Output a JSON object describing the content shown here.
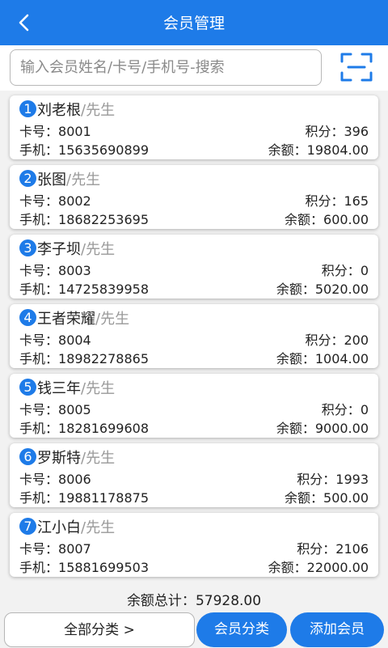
{
  "header": {
    "title": "会员管理"
  },
  "search": {
    "placeholder": "输入会员姓名/卡号/手机号-搜索"
  },
  "labels": {
    "card": "卡号：",
    "points": "积分：",
    "phone": "手机：",
    "balance": "余额："
  },
  "members": [
    {
      "index": "1",
      "name": "刘老根",
      "title": "/先生",
      "card": "8001",
      "points": "396",
      "phone": "15635690899",
      "balance": "19804.00"
    },
    {
      "index": "2",
      "name": "张图",
      "title": "/先生",
      "card": "8002",
      "points": "165",
      "phone": "18682253695",
      "balance": "600.00"
    },
    {
      "index": "3",
      "name": "李子坝",
      "title": "/先生",
      "card": "8003",
      "points": "0",
      "phone": "14725839958",
      "balance": "5020.00"
    },
    {
      "index": "4",
      "name": "王者荣耀",
      "title": "/先生",
      "card": "8004",
      "points": "200",
      "phone": "18982278865",
      "balance": "1004.00"
    },
    {
      "index": "5",
      "name": "钱三年",
      "title": "/先生",
      "card": "8005",
      "points": "0",
      "phone": "18281699608",
      "balance": "9000.00"
    },
    {
      "index": "6",
      "name": "罗斯特",
      "title": "/先生",
      "card": "8006",
      "points": "1993",
      "phone": "19881178875",
      "balance": "500.00"
    },
    {
      "index": "7",
      "name": "江小白",
      "title": "/先生",
      "card": "8007",
      "points": "2106",
      "phone": "15881699503",
      "balance": "22000.00"
    }
  ],
  "summary": {
    "label": "余额总计：",
    "value": "57928.00"
  },
  "bottom": {
    "all_category": "全部分类 >",
    "member_category": "会员分类",
    "add_member": "添加会员"
  },
  "colors": {
    "primary": "#1e7be8"
  },
  "icons": {
    "back": "chevron-left-icon",
    "scan": "scan-icon"
  }
}
